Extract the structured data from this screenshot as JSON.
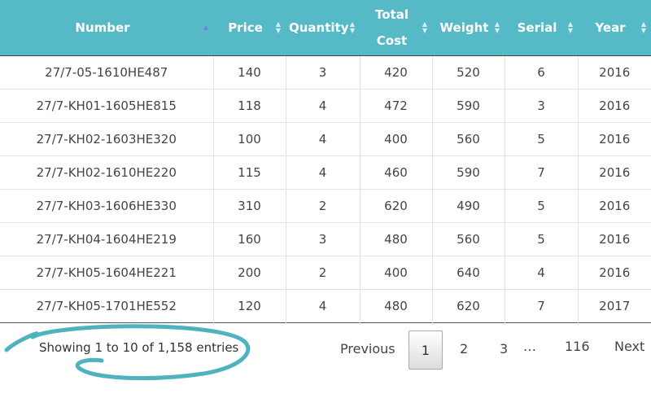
{
  "table": {
    "columns": [
      {
        "label": "Number",
        "sort": "asc"
      },
      {
        "label": "Price",
        "sort": "both"
      },
      {
        "label": "Quantity",
        "sort": "both"
      },
      {
        "label": "Total Cost",
        "sort": "both"
      },
      {
        "label": "Weight",
        "sort": "both"
      },
      {
        "label": "Serial",
        "sort": "both"
      },
      {
        "label": "Year",
        "sort": "both"
      }
    ],
    "rows": [
      [
        "27/7-05-1610HE487",
        "140",
        "3",
        "420",
        "520",
        "6",
        "2016"
      ],
      [
        "27/7-KH01-1605HE815",
        "118",
        "4",
        "472",
        "590",
        "3",
        "2016"
      ],
      [
        "27/7-KH02-1603HE320",
        "100",
        "4",
        "400",
        "560",
        "5",
        "2016"
      ],
      [
        "27/7-KH02-1610HE220",
        "115",
        "4",
        "460",
        "590",
        "7",
        "2016"
      ],
      [
        "27/7-KH03-1606HE330",
        "310",
        "2",
        "620",
        "490",
        "5",
        "2016"
      ],
      [
        "27/7-KH04-1604HE219",
        "160",
        "3",
        "480",
        "560",
        "5",
        "2016"
      ],
      [
        "27/7-KH05-1604HE221",
        "200",
        "2",
        "400",
        "640",
        "4",
        "2016"
      ],
      [
        "27/7-KH05-1701HE552",
        "120",
        "4",
        "480",
        "620",
        "7",
        "2017"
      ]
    ]
  },
  "footer": {
    "info": "Showing 1 to 10 of 1,158 entries",
    "pagination": {
      "previous": "Previous",
      "current": "1",
      "page2": "2",
      "page3": "3",
      "ellipsis": "…",
      "last": "116",
      "next": "Next"
    }
  },
  "colors": {
    "header_bg": "#55b9c6",
    "annotation_circle": "#4fb3bf",
    "sort_active": "#7b7ed9"
  }
}
